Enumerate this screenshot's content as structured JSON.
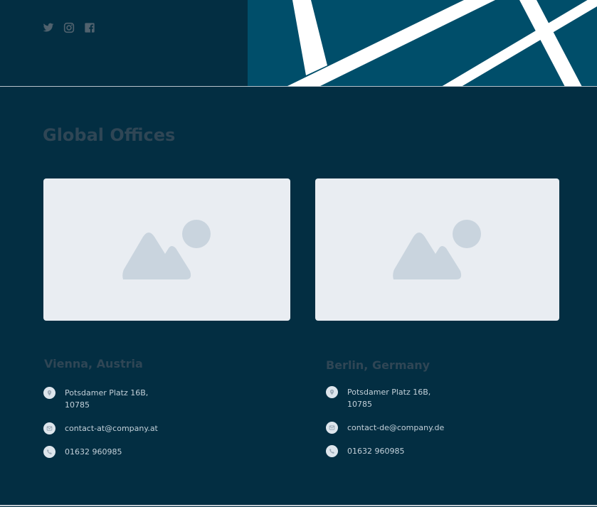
{
  "social": {
    "icons": [
      "twitter-icon",
      "instagram-icon",
      "facebook-icon"
    ]
  },
  "section": {
    "title": "Global Offices"
  },
  "offices": [
    {
      "name": "Vienna, Austria",
      "address": "Potsdamer Platz 16B,\n10785",
      "email": "contact-at@company.at",
      "phone": "01632 960985"
    },
    {
      "name": "Berlin, Germany",
      "address": "Potsdamer Platz 16B,\n10785",
      "email": "contact-de@company.de",
      "phone": "01632 960985"
    }
  ],
  "colors": {
    "background": "#032e42",
    "hero": "#004e6a",
    "muted_heading": "#2f4655",
    "placeholder": "#e9edf2"
  }
}
